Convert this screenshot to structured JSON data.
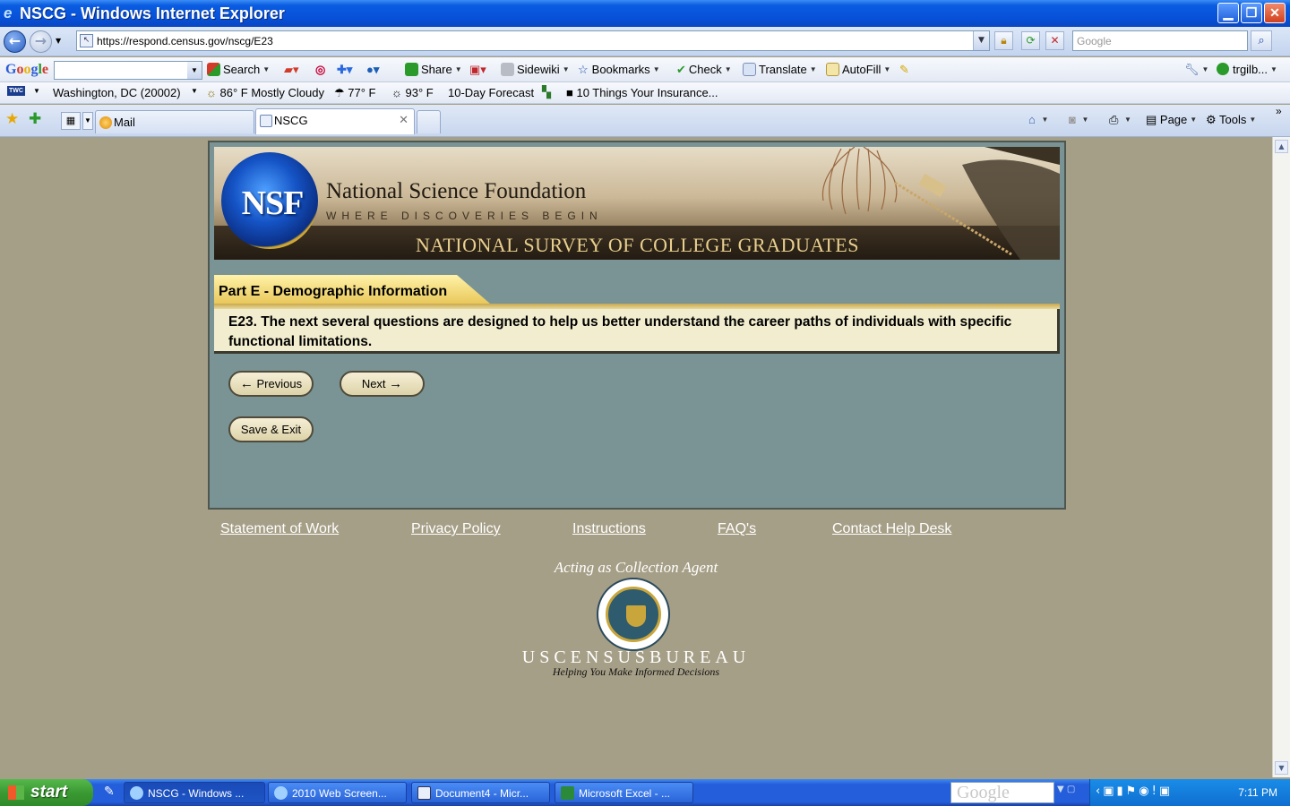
{
  "window": {
    "title": "NSCG - Windows Internet Explorer",
    "url": "https://respond.census.gov/nscg/E23",
    "search_placeholder": "Google"
  },
  "google_toolbar": {
    "logo": "Google",
    "items": [
      "Search",
      "Share",
      "Sidewiki",
      "Bookmarks",
      "Check",
      "Translate",
      "AutoFill"
    ],
    "user": "trgilb..."
  },
  "twc_toolbar": {
    "logo": "TWC",
    "location": "Washington, DC (20002)",
    "weather_now": "86° F Mostly Cloudy",
    "temp_a": "77° F",
    "temp_b": "93° F",
    "forecast": "10-Day Forecast",
    "video": "10 Things Your Insurance..."
  },
  "tabs": [
    {
      "label": "Mail",
      "active": false
    },
    {
      "label": "NSCG",
      "active": true
    }
  ],
  "command_bar": {
    "page": "Page",
    "tools": "Tools"
  },
  "banner": {
    "org_letters": "NSF",
    "org_name": "National Science Foundation",
    "tagline": "WHERE DISCOVERIES BEGIN",
    "survey_title": "NATIONAL SURVEY OF COLLEGE GRADUATES"
  },
  "section": {
    "title": "Part E - Demographic Information"
  },
  "question": {
    "text": "E23. The next several questions are designed to help us better understand the career paths of individuals with specific functional limitations."
  },
  "buttons": {
    "previous": "Previous",
    "next": "Next",
    "save_exit": "Save & Exit"
  },
  "footer": {
    "links": [
      "Statement of Work",
      "Privacy Policy",
      "Instructions",
      "FAQ's",
      "Contact Help Desk"
    ],
    "agent": "Acting as Collection Agent",
    "seal_text": "U.S. DEPARTMENT OF COMMERCE · BUREAU OF THE CENSUS",
    "bureau": "USCENSUSBUREAU",
    "bureau_tag": "Helping You Make Informed Decisions"
  },
  "taskbar": {
    "start": "start",
    "tasks": [
      {
        "label": "NSCG - Windows ...",
        "active": true
      },
      {
        "label": "2010 Web Screen...",
        "active": false
      },
      {
        "label": "Document4 - Micr...",
        "active": false
      },
      {
        "label": "Microsoft Excel - ...",
        "active": false
      }
    ],
    "deskbar": "Google",
    "clock": "7:11 PM"
  }
}
